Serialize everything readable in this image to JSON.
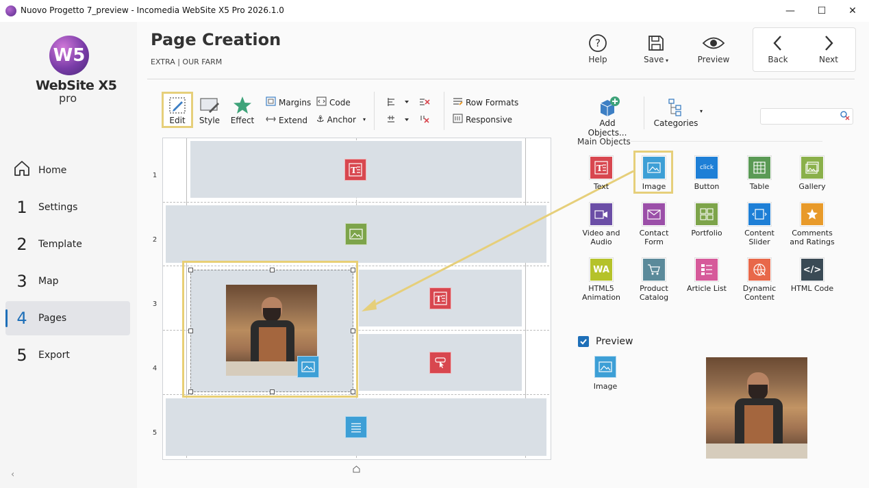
{
  "window": {
    "title": "Nuovo Progetto 7_preview - Incomedia WebSite X5 Pro 2026.1.0",
    "controls": [
      "—",
      "☐",
      "✕"
    ]
  },
  "logo": {
    "mark": "W5",
    "name": "WebSite X5",
    "edition": "pro"
  },
  "nav": [
    {
      "num": "",
      "label": "Home"
    },
    {
      "num": "1",
      "label": "Settings"
    },
    {
      "num": "2",
      "label": "Template"
    },
    {
      "num": "3",
      "label": "Map"
    },
    {
      "num": "4",
      "label": "Pages"
    },
    {
      "num": "5",
      "label": "Export"
    }
  ],
  "header": {
    "title": "Page Creation",
    "subtitle": "EXTRA | OUR FARM"
  },
  "topbar": {
    "help": "Help",
    "save": "Save",
    "preview": "Preview",
    "back": "Back",
    "next": "Next"
  },
  "toolbar": {
    "edit": "Edit",
    "style": "Style",
    "effect": "Effect",
    "margins": "Margins",
    "extend": "Extend",
    "code": "Code",
    "anchor": "Anchor",
    "row_formats": "Row Formats",
    "responsive": "Responsive",
    "add_objects": "Add Objects...",
    "categories": "Categories"
  },
  "grid": {
    "rows": [
      "1",
      "2",
      "3",
      "4",
      "5"
    ]
  },
  "objects_panel": {
    "heading": "Main Objects",
    "items": [
      {
        "label": "Text",
        "icon": "text-icon",
        "color": "#d8474f"
      },
      {
        "label": "Image",
        "icon": "image-icon",
        "color": "#3d9fd6"
      },
      {
        "label": "Button",
        "icon": "button-icon",
        "color": "#1e7fd6",
        "glyph": "click"
      },
      {
        "label": "Table",
        "icon": "table-icon",
        "color": "#5a9a55"
      },
      {
        "label": "Gallery",
        "icon": "gallery-icon",
        "color": "#8ab04a"
      },
      {
        "label": "Video and Audio",
        "icon": "video-icon",
        "color": "#6b4ea6"
      },
      {
        "label": "Contact Form",
        "icon": "contact-form-icon",
        "color": "#9b4fa8"
      },
      {
        "label": "Portfolio",
        "icon": "portfolio-icon",
        "color": "#7da44a"
      },
      {
        "label": "Content Slider",
        "icon": "content-slider-icon",
        "color": "#1e7fd6"
      },
      {
        "label": "Comments and Ratings",
        "icon": "comments-icon",
        "color": "#e89a2a"
      },
      {
        "label": "HTML5 Animation",
        "icon": "html5-animation-icon",
        "color": "#b5c22a",
        "glyph": "WA"
      },
      {
        "label": "Product Catalog",
        "icon": "product-catalog-icon",
        "color": "#5b8a9a"
      },
      {
        "label": "Article List",
        "icon": "article-list-icon",
        "color": "#d65a9a"
      },
      {
        "label": "Dynamic Content",
        "icon": "dynamic-content-icon",
        "color": "#e8684a"
      },
      {
        "label": "HTML Code",
        "icon": "html-code-icon",
        "color": "#3a4a55",
        "glyph": "</>"
      }
    ]
  },
  "preview_panel": {
    "label": "Preview",
    "checked": true,
    "object_label": "Image"
  }
}
